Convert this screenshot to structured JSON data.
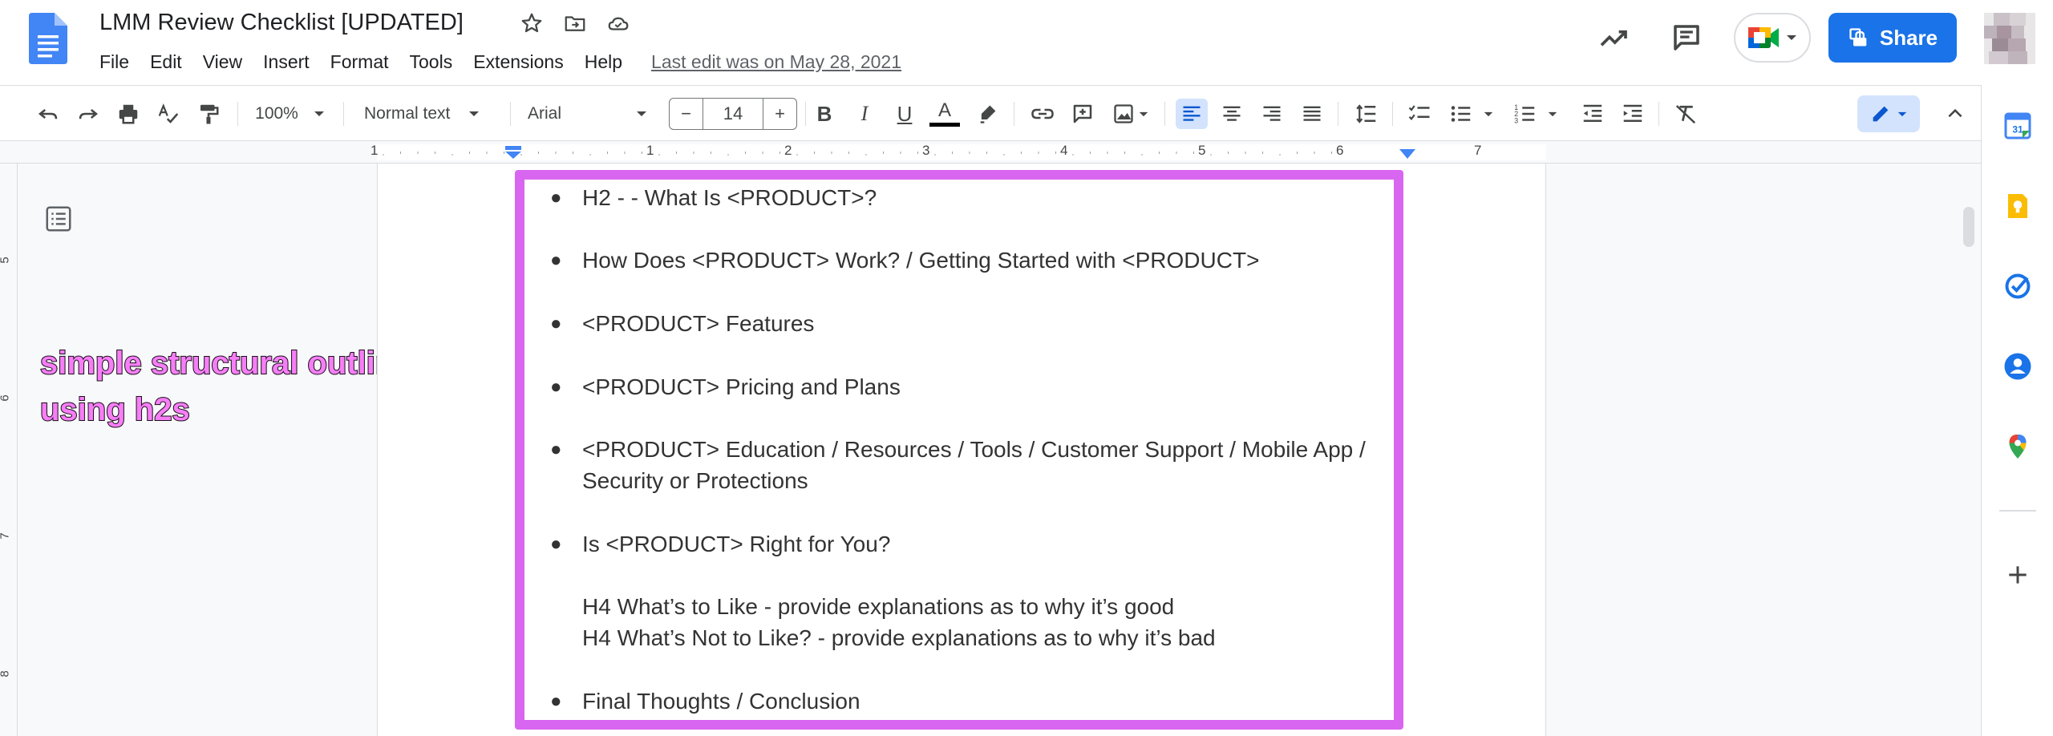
{
  "document": {
    "title": "LMM Review Checklist [UPDATED]",
    "last_edit": "Last edit was on May 28, 2021"
  },
  "menu": [
    "File",
    "Edit",
    "View",
    "Insert",
    "Format",
    "Tools",
    "Extensions",
    "Help"
  ],
  "header": {
    "share_label": "Share"
  },
  "toolbar": {
    "zoom": "100%",
    "style": "Normal text",
    "font": "Arial",
    "font_size": "14",
    "minus": "−",
    "plus": "+"
  },
  "ruler": {
    "numbers": [
      "1",
      "1",
      "2",
      "3",
      "4",
      "5",
      "6",
      "7"
    ]
  },
  "vruler": {
    "numbers": [
      "5",
      "6",
      "7",
      "8"
    ]
  },
  "annotation": {
    "line1": "simple structural outline",
    "line2": "using h2s"
  },
  "content": {
    "bullets": [
      "H2 - - What Is <PRODUCT>?",
      "How Does <PRODUCT> Work? / Getting Started with <PRODUCT>",
      "<PRODUCT> Features",
      "<PRODUCT> Pricing and Plans",
      "<PRODUCT> Education / Resources / Tools / Customer Support / Mobile App /",
      "Is <PRODUCT> Right for You?",
      "Final Thoughts / Conclusion"
    ],
    "bullet5_cont": "Security or Protections",
    "h4_like": "H4 What’s to Like - provide explanations as to why it’s good",
    "h4_not_like": "H4 What’s Not to Like? - provide explanations as to why it’s bad",
    "bullet_char": "●"
  },
  "colors": {
    "accent": "#1a73e8",
    "highlight_box": "#d966f0",
    "annotation_text": "#f77ef7"
  },
  "icons": {
    "header": [
      "docs-logo",
      "star-icon",
      "move-folder-icon",
      "cloud-saved-icon",
      "activity-trend-icon",
      "comments-icon",
      "meet-icon",
      "share-lock-icon"
    ],
    "side_panel": [
      "calendar-icon",
      "keep-icon",
      "tasks-icon",
      "contacts-icon",
      "maps-icon",
      "add-icon"
    ]
  },
  "side_panel": {
    "calendar_day": "31"
  }
}
